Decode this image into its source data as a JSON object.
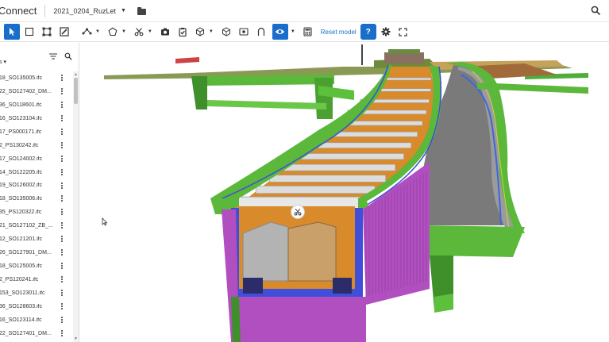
{
  "app": {
    "title": "Connect"
  },
  "project": {
    "name": "2021_0204_RuzLet"
  },
  "toolbar": {
    "reset_label": "Reset model"
  },
  "sidebar": {
    "sort_label": "s",
    "files": [
      "18_SO135005.ifc",
      "22_SO127402_DM...",
      "36_SO118601.ifc",
      "16_SO123104.ifc",
      "17_PS000171.ifc",
      "2_PS130242.ifc",
      "17_SO124002.ifc",
      "14_SO122205.ifc",
      "19_SO126002.ifc",
      "18_SO135006.ifc",
      "35_PS120322.ifc",
      "21_SO127102_ZB_...",
      "12_SO121201.ifc",
      "26_SO127901_DM...",
      "18_SO125005.ifc",
      "2_PS120241.ifc",
      "153_SO123011.ifc",
      "36_SO128603.ifc",
      "16_SO123114.ifc",
      "22_SO127401_DM..."
    ]
  },
  "colors": {
    "accent": "#1a6ecb",
    "bridge_green": "#5fbf3a",
    "pier_magenta": "#b24fc0",
    "deck_orange": "#d98a2b"
  }
}
